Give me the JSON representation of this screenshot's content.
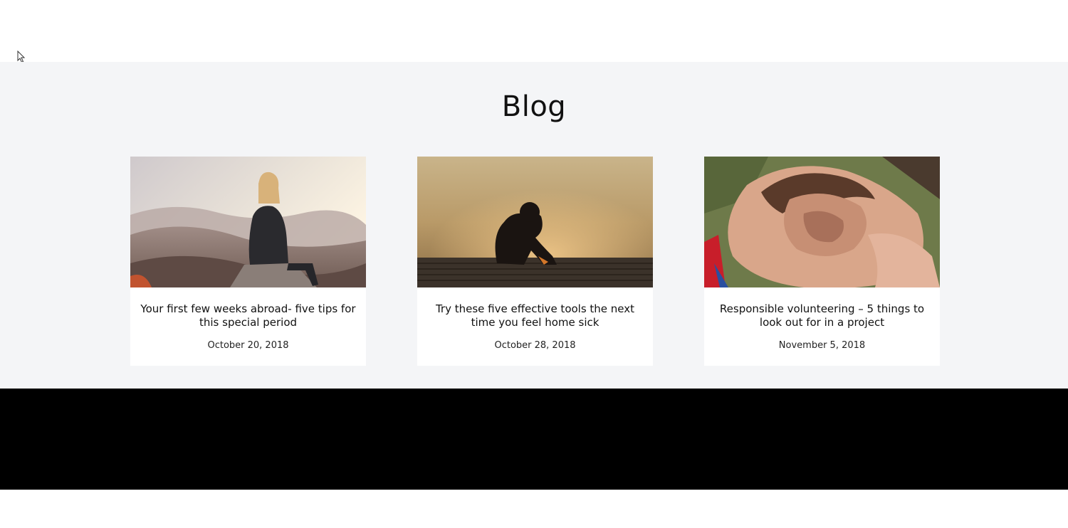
{
  "blog": {
    "heading": "Blog",
    "posts": [
      {
        "title": "Your first few weeks abroad- five tips for this special period",
        "date": "October 20, 2018",
        "image": "woman-on-mountain-image"
      },
      {
        "title": "Try these five effective tools the next time you feel home sick",
        "date": "October 28, 2018",
        "image": "sad-person-on-dock-image"
      },
      {
        "title": "Responsible volunteering – 5 things to look out for in a project",
        "date": "November 5, 2018",
        "image": "joined-hands-image"
      }
    ]
  },
  "colors": {
    "section_bg": "#f4f5f7",
    "card_bg": "#ffffff",
    "footer_bg": "#000000",
    "text": "#111111"
  }
}
